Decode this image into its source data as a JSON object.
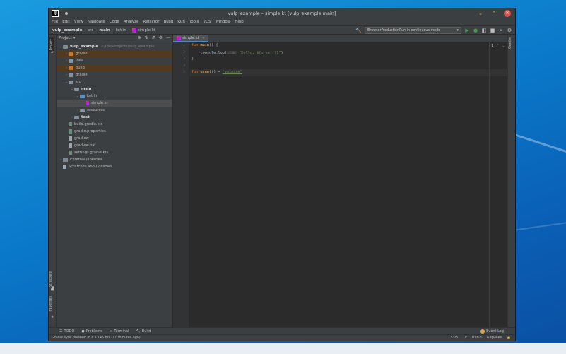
{
  "window": {
    "title": "vulp_example – simple.kt [vulp_example.main]",
    "logo_text": "IJ",
    "controls": [
      "⌄",
      "⌃",
      "✕"
    ]
  },
  "menu": [
    "File",
    "Edit",
    "View",
    "Navigate",
    "Code",
    "Analyze",
    "Refactor",
    "Build",
    "Run",
    "Tools",
    "VCS",
    "Window",
    "Help"
  ],
  "breadcrumb": [
    "vulp_example",
    "src",
    "main",
    "kotlin",
    "simple.kt"
  ],
  "run_config": {
    "label": "BrowserProductionRun in continuous mode",
    "dropdown": "▾"
  },
  "toolbar_icons": {
    "build": "🔨",
    "run": "▶",
    "debug": "●",
    "coverage": "◧",
    "stop": "■",
    "search": "⌕",
    "settings": "⚙"
  },
  "project_panel": {
    "title": "Project",
    "dropdown": "▾",
    "tools": [
      "⊕",
      "⇅",
      "⇵",
      "⚙",
      "—"
    ],
    "tree": [
      {
        "label": "vulp_example",
        "suffix": "~/IdeaProjects/vulp_example",
        "arrow": "⌄",
        "depth": 0,
        "icon": "folder-src"
      },
      {
        "label": "gradle",
        "arrow": "›",
        "depth": 1,
        "icon": "folder-orange",
        "hl": "orange"
      },
      {
        "label": "idea",
        "arrow": "›",
        "depth": 1,
        "icon": "folder"
      },
      {
        "label": "build",
        "arrow": "›",
        "depth": 1,
        "icon": "folder-orange",
        "hl": "orange"
      },
      {
        "label": "gradle",
        "arrow": "›",
        "depth": 1,
        "icon": "folder"
      },
      {
        "label": "src",
        "arrow": "⌄",
        "depth": 1,
        "icon": "folder"
      },
      {
        "label": "main",
        "arrow": "⌄",
        "depth": 2,
        "icon": "folder",
        "bold": true
      },
      {
        "label": "kotlin",
        "arrow": "⌄",
        "depth": 3,
        "icon": "folder-blue"
      },
      {
        "label": "simple.kt",
        "arrow": "",
        "depth": 4,
        "icon": "file-kt",
        "selected": true
      },
      {
        "label": "resources",
        "arrow": "›",
        "depth": 3,
        "icon": "folder"
      },
      {
        "label": "test",
        "arrow": "›",
        "depth": 2,
        "icon": "folder",
        "bold": true
      },
      {
        "label": "build.gradle.kts",
        "arrow": "",
        "depth": 1,
        "icon": "file-gradle"
      },
      {
        "label": "gradle.properties",
        "arrow": "",
        "depth": 1,
        "icon": "file-gradle"
      },
      {
        "label": "gradlew",
        "arrow": "",
        "depth": 1,
        "icon": "file"
      },
      {
        "label": "gradlew.bat",
        "arrow": "",
        "depth": 1,
        "icon": "file"
      },
      {
        "label": "settings.gradle.kts",
        "arrow": "",
        "depth": 1,
        "icon": "file-gradle"
      },
      {
        "label": "External Libraries",
        "arrow": "›",
        "depth": 0,
        "icon": "libs"
      },
      {
        "label": "Scratches and Consoles",
        "arrow": "",
        "depth": 0,
        "icon": "file"
      }
    ]
  },
  "left_strip": {
    "project": "Project",
    "structure": "Structure",
    "favorites": "Favorites"
  },
  "right_strip": {
    "gradle": "Gradle"
  },
  "editor": {
    "tab_label": "simple.kt",
    "tab_close": "×",
    "line_numbers": [
      "1",
      "2",
      "3",
      "4",
      "5"
    ],
    "inspect": {
      "count": "1",
      "check": "✓",
      "up": "⌃",
      "down": "⌄"
    },
    "lines": {
      "l1": {
        "kw": "fun ",
        "fn": "main",
        "rest": "() {"
      },
      "l2": {
        "pre": "    console.log(",
        "hint": "...a:",
        "str": " \"Hello, ${greet()}\"",
        "post": ")"
      },
      "l3": {
        "text": "}"
      },
      "l5": {
        "kw": "fun ",
        "fn": "greet",
        "mid": "() = ",
        "str": "\"vulpine\""
      }
    }
  },
  "bottom_tools": [
    {
      "icon": "☰",
      "label": "TODO"
    },
    {
      "icon": "●",
      "label": "Problems"
    },
    {
      "icon": "▭",
      "label": "Terminal"
    },
    {
      "icon": "🔨",
      "label": "Build"
    }
  ],
  "event_log": "Event Log",
  "status": {
    "message": "Gradle sync finished in 8 s 145 ms (11 minutes ago)",
    "position": "5:25",
    "line_sep": "LF",
    "encoding": "UTF-8",
    "indent": "4 spaces",
    "lock": "🔒"
  }
}
